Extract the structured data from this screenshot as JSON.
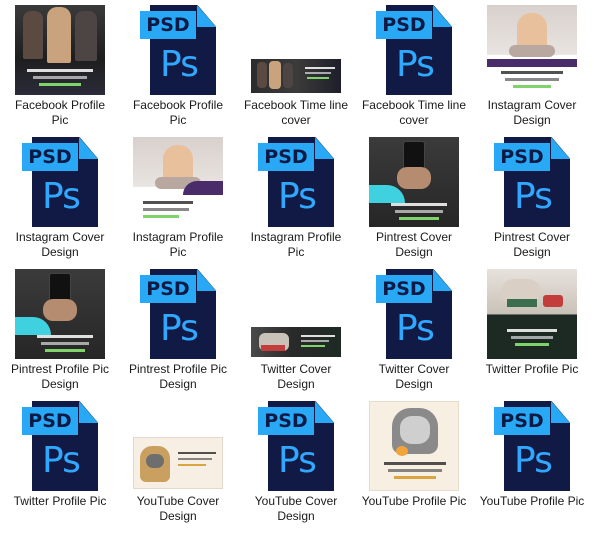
{
  "files": [
    {
      "label": "Facebook Profile Pic",
      "icon": "image-thumbnail",
      "kind": "photo-dark"
    },
    {
      "label": "Facebook Profile Pic",
      "icon": "psd-file-icon",
      "badge": "PSD",
      "glyph": "Ps"
    },
    {
      "label": "Facebook Time line cover",
      "icon": "image-thumbnail",
      "kind": "cover-dark"
    },
    {
      "label": "Facebook Time line cover",
      "icon": "psd-file-icon",
      "badge": "PSD",
      "glyph": "Ps"
    },
    {
      "label": "Instagram Cover Design",
      "icon": "image-thumbnail",
      "kind": "photo-light"
    },
    {
      "label": "Instagram Cover Design",
      "icon": "psd-file-icon",
      "badge": "PSD",
      "glyph": "Ps"
    },
    {
      "label": "Instagram Profile Pic",
      "icon": "image-thumbnail",
      "kind": "photo-light"
    },
    {
      "label": "Instagram Profile Pic",
      "icon": "psd-file-icon",
      "badge": "PSD",
      "glyph": "Ps"
    },
    {
      "label": "Pintrest Cover Design",
      "icon": "image-thumbnail",
      "kind": "phone-dark"
    },
    {
      "label": "Pintrest Cover Design",
      "icon": "psd-file-icon",
      "badge": "PSD",
      "glyph": "Ps"
    },
    {
      "label": "Pintrest Profile Pic Design",
      "icon": "image-thumbnail",
      "kind": "phone-dark"
    },
    {
      "label": "Pintrest Profile Pic Design",
      "icon": "psd-file-icon",
      "badge": "PSD",
      "glyph": "Ps"
    },
    {
      "label": "Twitter Cover Design",
      "icon": "image-thumbnail",
      "kind": "cover-dark"
    },
    {
      "label": "Twitter Cover Design",
      "icon": "psd-file-icon",
      "badge": "PSD",
      "glyph": "Ps"
    },
    {
      "label": "Twitter Profile Pic",
      "icon": "image-thumbnail",
      "kind": "photo-dark"
    },
    {
      "label": "Twitter Profile Pic",
      "icon": "psd-file-icon",
      "badge": "PSD",
      "glyph": "Ps"
    },
    {
      "label": "YouTube Cover Design",
      "icon": "image-thumbnail",
      "kind": "cover-light"
    },
    {
      "label": "YouTube Cover Design",
      "icon": "psd-file-icon",
      "badge": "PSD",
      "glyph": "Ps"
    },
    {
      "label": "YouTube Profile Pic",
      "icon": "image-thumbnail",
      "kind": "photo-cream"
    },
    {
      "label": "YouTube Profile Pic",
      "icon": "psd-file-icon",
      "badge": "PSD",
      "glyph": "Ps"
    }
  ],
  "colors": {
    "psd_sheet": "#101a45",
    "psd_accent": "#29a9f5",
    "label_text": "#1a1a1a"
  }
}
